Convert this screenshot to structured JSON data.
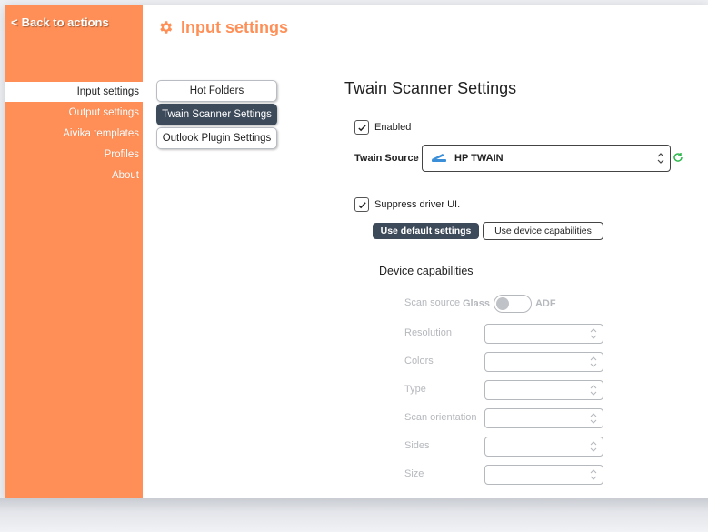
{
  "sidebar": {
    "back_label": "Back to actions",
    "back_chevron": "<",
    "items": [
      {
        "label": "Input settings",
        "active": true
      },
      {
        "label": "Output settings",
        "active": false
      },
      {
        "label": "Aivika templates",
        "active": false
      },
      {
        "label": "Profiles",
        "active": false
      },
      {
        "label": "About",
        "active": false
      }
    ]
  },
  "header": {
    "title": "Input settings",
    "icon": "gear-icon"
  },
  "subtabs": [
    {
      "label": "Hot Folders",
      "active": false
    },
    {
      "label": "Twain Scanner Settings",
      "active": true
    },
    {
      "label": "Outlook Plugin Settings",
      "active": false
    }
  ],
  "main": {
    "title": "Twain Scanner Settings",
    "enabled_label": "Enabled",
    "enabled_checked": true,
    "twain_source_label": "Twain Source",
    "twain_source_value": "HP TWAIN",
    "suppress_label": "Suppress driver UI.",
    "suppress_checked": true,
    "btn_default": "Use default settings",
    "btn_device": "Use device capabilities",
    "device_caps_title": "Device capabilities",
    "scan_source_label": "Scan source",
    "scan_source_left": "Glass",
    "scan_source_right": "ADF",
    "fields": [
      "Resolution",
      "Colors",
      "Type",
      "Scan orientation",
      "Sides",
      "Size"
    ]
  },
  "colors": {
    "accent": "#ff8f56",
    "dark": "#3d4a5a",
    "disabled": "#b5b8bd",
    "refresh": "#2fb84f",
    "scanner_icon": "#3a8fd8"
  }
}
